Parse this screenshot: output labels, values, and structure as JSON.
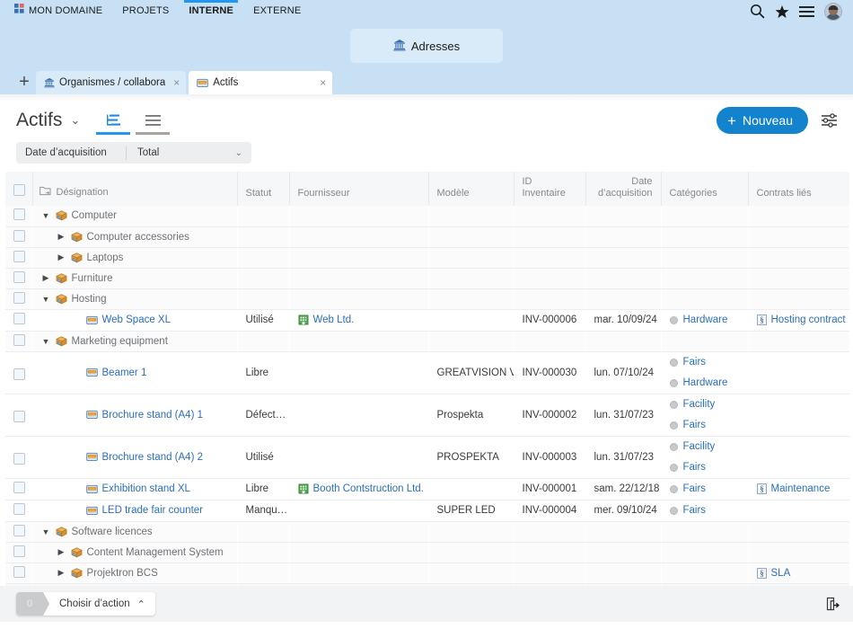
{
  "topbar": {
    "nav": [
      {
        "label": "MON DOMAINE",
        "icon": "domain-icon",
        "active": false
      },
      {
        "label": "PROJETS",
        "active": false
      },
      {
        "label": "INTERNE",
        "active": true
      },
      {
        "label": "EXTERNE",
        "active": false
      }
    ],
    "icons": [
      {
        "name": "search-icon"
      },
      {
        "name": "favorites-star-icon"
      },
      {
        "name": "menu-hamburger-icon"
      },
      {
        "name": "avatar"
      }
    ],
    "accent": "#2196f3",
    "background": "#c7e0f4"
  },
  "modulebar": {
    "button_label": "Adresses",
    "button_icon": "bank-building-icon"
  },
  "tabs": {
    "add_label": "+",
    "items": [
      {
        "label": "Organismes / collabora",
        "icon": "bank-building-icon",
        "active": false,
        "close": "×"
      },
      {
        "label": "Actifs",
        "icon": "asset-box-icon",
        "active": true,
        "close": "×"
      }
    ]
  },
  "toolbar": {
    "title": "Actifs",
    "title_caret": "⌄",
    "views": [
      {
        "name": "tree-view",
        "active": true
      },
      {
        "name": "list-view",
        "active": false
      }
    ],
    "new_button": "Nouveau",
    "new_button_plus": "+",
    "settings_icon": "settings-sliders-icon",
    "accent": "#1283cc"
  },
  "filter": {
    "label": "Date d’acquisition",
    "value": "Total",
    "caret": "⌄"
  },
  "table": {
    "columns": [
      {
        "key": "checkbox",
        "label": ""
      },
      {
        "key": "designation",
        "label": "Désignation",
        "icon": "folder-arrow-icon"
      },
      {
        "key": "statut",
        "label": "Statut"
      },
      {
        "key": "fournisseur",
        "label": "Fournisseur"
      },
      {
        "key": "modele",
        "label": "Modèle"
      },
      {
        "key": "id_inventaire",
        "label": "ID Inventaire"
      },
      {
        "key": "date_acquisition",
        "label": "Date d’acquisition"
      },
      {
        "key": "categories",
        "label": "Catégories"
      },
      {
        "key": "contrats",
        "label": "Contrats liés"
      }
    ],
    "rows": [
      {
        "type": "group",
        "indent": 1,
        "twisty": "▼",
        "label": "Computer",
        "statut": "",
        "fournisseur": "",
        "modele": "",
        "id": "",
        "date": "",
        "categories": [],
        "contracts": []
      },
      {
        "type": "group",
        "indent": 2,
        "twisty": "▶",
        "label": "Computer accessories",
        "statut": "",
        "fournisseur": "",
        "modele": "",
        "id": "",
        "date": "",
        "categories": [],
        "contracts": []
      },
      {
        "type": "group",
        "indent": 2,
        "twisty": "▶",
        "label": "Laptops",
        "statut": "",
        "fournisseur": "",
        "modele": "",
        "id": "",
        "date": "",
        "categories": [],
        "contracts": []
      },
      {
        "type": "group",
        "indent": 1,
        "twisty": "▶",
        "label": "Furniture",
        "statut": "",
        "fournisseur": "",
        "modele": "",
        "id": "",
        "date": "",
        "categories": [],
        "contracts": []
      },
      {
        "type": "group",
        "indent": 1,
        "twisty": "▼",
        "label": "Hosting",
        "statut": "",
        "fournisseur": "",
        "modele": "",
        "id": "",
        "date": "",
        "categories": [],
        "contracts": []
      },
      {
        "type": "item",
        "indent": 3,
        "twisty": "",
        "label": "Web Space XL",
        "statut": "Utilisé",
        "fournisseur": "Web Ltd.",
        "modele": "",
        "id": "INV-000006",
        "date": "mar. 10/09/24",
        "categories": [
          "Hardware"
        ],
        "contracts": [
          "Hosting contract"
        ]
      },
      {
        "type": "group",
        "indent": 1,
        "twisty": "▼",
        "label": "Marketing equipment",
        "statut": "",
        "fournisseur": "",
        "modele": "",
        "id": "",
        "date": "",
        "categories": [],
        "contracts": []
      },
      {
        "type": "item",
        "indent": 3,
        "twisty": "",
        "label": "Beamer 1",
        "tall": true,
        "statut": "Libre",
        "fournisseur": "",
        "modele": "GREATVISION V",
        "id": "INV-000030",
        "date": "lun. 07/10/24",
        "categories": [
          "Fairs",
          "Hardware"
        ],
        "contracts": []
      },
      {
        "type": "item",
        "indent": 3,
        "twisty": "",
        "label": "Brochure stand (A4) 1",
        "tall": true,
        "statut": "Défect…",
        "fournisseur": "",
        "modele": "Prospekta",
        "id": "INV-000002",
        "date": "lun. 31/07/23",
        "categories": [
          "Facility",
          "Fairs"
        ],
        "contracts": []
      },
      {
        "type": "item",
        "indent": 3,
        "twisty": "",
        "label": "Brochure stand (A4) 2",
        "tall": true,
        "statut": "Utilisé",
        "fournisseur": "",
        "modele": "PROSPEKTA",
        "id": "INV-000003",
        "date": "lun. 31/07/23",
        "categories": [
          "Facility",
          "Fairs"
        ],
        "contracts": []
      },
      {
        "type": "item",
        "indent": 3,
        "twisty": "",
        "label": "Exhibition stand XL",
        "statut": "Libre",
        "fournisseur": "Booth Contstruction Ltd.",
        "modele": "",
        "id": "INV-000001",
        "date": "sam. 22/12/18",
        "categories": [
          "Fairs"
        ],
        "contracts": [
          "Maintenance"
        ]
      },
      {
        "type": "item",
        "indent": 3,
        "twisty": "",
        "label": "LED trade fair counter",
        "statut": "Manqu…",
        "fournisseur": "",
        "modele": "SUPER LED",
        "id": "INV-000004",
        "date": "mer. 09/10/24",
        "categories": [
          "Fairs"
        ],
        "contracts": []
      },
      {
        "type": "group",
        "indent": 1,
        "twisty": "▼",
        "label": "Software licences",
        "statut": "",
        "fournisseur": "",
        "modele": "",
        "id": "",
        "date": "",
        "categories": [],
        "contracts": []
      },
      {
        "type": "group",
        "indent": 2,
        "twisty": "▶",
        "label": "Content Management System",
        "statut": "",
        "fournisseur": "",
        "modele": "",
        "id": "",
        "date": "",
        "categories": [],
        "contracts": []
      },
      {
        "type": "group",
        "indent": 2,
        "twisty": "▶",
        "label": "Projektron BCS",
        "statut": "",
        "fournisseur": "",
        "modele": "",
        "id": "",
        "date": "",
        "categories": [],
        "contracts": [
          "SLA"
        ]
      },
      {
        "type": "blank",
        "indent": 0,
        "twisty": "",
        "label": "",
        "statut": "",
        "fournisseur": "",
        "modele": "",
        "id": "",
        "date": "",
        "categories": [],
        "contracts": []
      }
    ]
  },
  "bottombar": {
    "selection_count": "0",
    "action_label": "Choisir d’action",
    "action_caret": "⌃",
    "export_icon": "export-document-icon"
  }
}
